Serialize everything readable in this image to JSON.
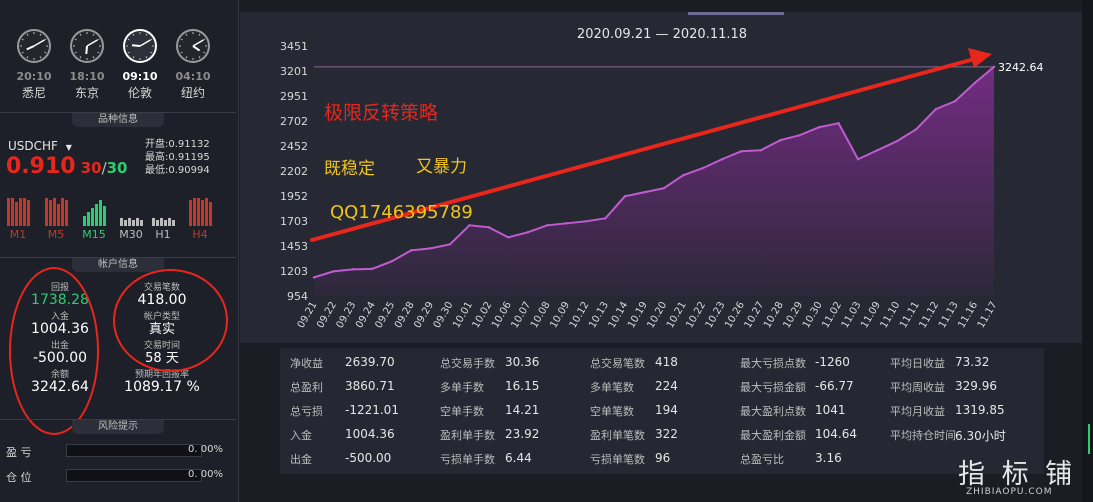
{
  "clocks": [
    {
      "time": "20:10",
      "city": "悉尼",
      "active": false,
      "hour": 8,
      "minute": 10
    },
    {
      "time": "18:10",
      "city": "东京",
      "active": false,
      "hour": 6,
      "minute": 10
    },
    {
      "time": "09:10",
      "city": "伦敦",
      "active": true,
      "hour": 9,
      "minute": 10
    },
    {
      "time": "04:10",
      "city": "纽约",
      "active": false,
      "hour": 4,
      "minute": 10
    }
  ],
  "symbol_section": {
    "title": "品种信息",
    "symbol": "USDCHF",
    "price": "0.910",
    "spread_a": "30",
    "spread_sep": "/",
    "spread_b": "30",
    "open_label": "开盘:",
    "open": "0.91132",
    "high_label": "最高:",
    "high": "0.91195",
    "low_label": "最低:",
    "low": "0.90994",
    "timeframes": [
      {
        "label": "M1",
        "color": "#c0392b"
      },
      {
        "label": "M5",
        "color": "#c0392b"
      },
      {
        "label": "M15",
        "color": "#2ecc71"
      },
      {
        "label": "M30",
        "color": "#bdbdbd"
      },
      {
        "label": "H1",
        "color": "#bdbdbd"
      },
      {
        "label": "H4",
        "color": "#c0392b"
      }
    ]
  },
  "account_section": {
    "title": "帐户信息",
    "return_label": "回报",
    "return_value": "1738.28",
    "deposit_label": "入金",
    "deposit_value": "1004.36",
    "withdraw_label": "出金",
    "withdraw_value": "-500.00",
    "balance_label": "余额",
    "balance_value": "3242.64",
    "trades_label": "交易笔数",
    "trades_value": "418.00",
    "account_type_label": "帐户类型",
    "account_type_value": "真实",
    "trade_time_label": "交易时间",
    "trade_time_value": "58 天",
    "annual_label": "预期年回报率",
    "annual_value": "1089.17 %"
  },
  "risk_section": {
    "title": "风险提示",
    "pnl_label": "盈 亏",
    "pnl_value": "0. 00%",
    "position_label": "仓 位",
    "position_value": "0. 00%"
  },
  "overlay_text": {
    "strategy": "极限反转策略",
    "stable": "既稳定",
    "explosive": "又暴力",
    "qq": "QQ1746395789"
  },
  "watermark": {
    "cn": "指 标 铺",
    "en": "ZHIBIAOPU.COM"
  },
  "stats": [
    {
      "label": "净收益",
      "value": "2639.70"
    },
    {
      "label": "总交易手数",
      "value": "30.36"
    },
    {
      "label": "总交易笔数",
      "value": "418"
    },
    {
      "label": "最大亏损点数",
      "value": "-1260"
    },
    {
      "label": "平均日收益",
      "value": "73.32"
    },
    {
      "label": "总盈利",
      "value": "3860.71"
    },
    {
      "label": "多单手数",
      "value": "16.15"
    },
    {
      "label": "多单笔数",
      "value": "224"
    },
    {
      "label": "最大亏损金额",
      "value": "-66.77"
    },
    {
      "label": "平均周收益",
      "value": "329.96"
    },
    {
      "label": "总亏损",
      "value": "-1221.01"
    },
    {
      "label": "空单手数",
      "value": "14.21"
    },
    {
      "label": "空单笔数",
      "value": "194"
    },
    {
      "label": "最大盈利点数",
      "value": "1041"
    },
    {
      "label": "平均月收益",
      "value": "1319.85"
    },
    {
      "label": "入金",
      "value": "1004.36"
    },
    {
      "label": "盈利单手数",
      "value": "23.92"
    },
    {
      "label": "盈利单笔数",
      "value": "322"
    },
    {
      "label": "最大盈利金额",
      "value": "104.64"
    },
    {
      "label": "平均持仓时间",
      "value": "6.30小时"
    },
    {
      "label": "出金",
      "value": "-500.00"
    },
    {
      "label": "亏损单手数",
      "value": "6.44"
    },
    {
      "label": "亏损单笔数",
      "value": "96"
    },
    {
      "label": "总盈亏比",
      "value": "3.16"
    }
  ],
  "colors": {
    "accent_red": "#e8261c",
    "price_red": "#e8261c",
    "return_green": "#2ecc71",
    "overlay_yellow": "#f0c419",
    "area_purple": "#7b2c8a",
    "line_purple": "#c05bd0"
  },
  "chart_data": {
    "type": "area",
    "title": "2020.09.21 — 2020.11.18",
    "xlabel": "",
    "ylabel": "",
    "ylim": [
      954,
      3451
    ],
    "y_ticks": [
      954,
      1203,
      1453,
      1703,
      1952,
      2202,
      2452,
      2702,
      2951,
      3201,
      3451
    ],
    "x_ticks": [
      "09.21",
      "09.22",
      "09.23",
      "09.24",
      "09.25",
      "09.28",
      "09.29",
      "09.30",
      "10.01",
      "10.02",
      "10.06",
      "10.07",
      "10.08",
      "10.09",
      "10.12",
      "10.13",
      "10.14",
      "10.19",
      "10.20",
      "10.21",
      "10.22",
      "10.23",
      "10.26",
      "10.27",
      "10.28",
      "10.29",
      "10.30",
      "11.02",
      "11.03",
      "11.09",
      "11.10",
      "11.11",
      "11.12",
      "11.13",
      "11.16",
      "11.17"
    ],
    "end_label": "3242.64",
    "series": [
      {
        "values": [
          1140,
          1200,
          1220,
          1225,
          1300,
          1410,
          1430,
          1470,
          1660,
          1640,
          1540,
          1590,
          1660,
          1680,
          1700,
          1730,
          1950,
          1990,
          2030,
          2160,
          2230,
          2320,
          2400,
          2410,
          2510,
          2560,
          2640,
          2680,
          2320,
          2410,
          2500,
          2620,
          2820,
          2900,
          3080,
          3242.64
        ]
      }
    ],
    "reference_line": 3242.64,
    "grid": false
  }
}
